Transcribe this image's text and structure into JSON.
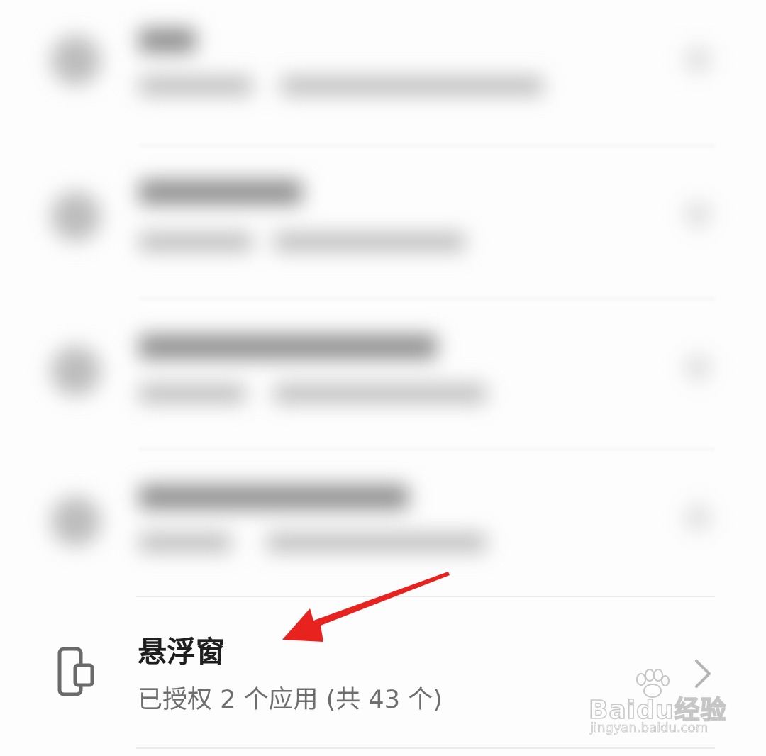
{
  "floating_window": {
    "title": "悬浮窗",
    "subtitle": "已授权 2 个应用 (共 43 个)",
    "icon": "phone-floating-window-icon",
    "chevron_icon": "chevron-right-icon"
  },
  "watermark": {
    "brand": "Baidu经验",
    "url": "jingyan.baidu.com"
  },
  "annotation": {
    "arrow_color": "#e8231f"
  }
}
